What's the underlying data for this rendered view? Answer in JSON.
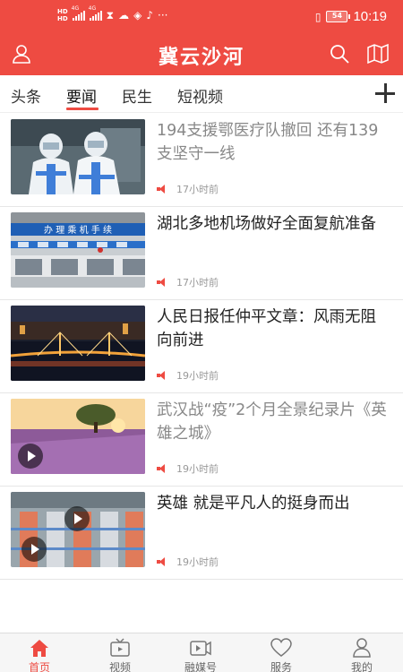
{
  "status_bar": {
    "hd1": "HD",
    "hd2": "HD",
    "net1": "4G",
    "net2": "4G",
    "battery": "54",
    "time": "10:19"
  },
  "header": {
    "title": "冀云沙河",
    "icons": [
      "user-icon",
      "search-icon",
      "map-icon"
    ]
  },
  "tabs": [
    {
      "label": "头条",
      "active": false
    },
    {
      "label": "要闻",
      "active": true
    },
    {
      "label": "民生",
      "active": false
    },
    {
      "label": "短视频",
      "active": false
    }
  ],
  "articles": [
    {
      "headline": "194支援鄂医疗队撤回 还有139支坚守一线",
      "time": "17小时前",
      "read": true,
      "video": false
    },
    {
      "headline": "湖北多地机场做好全面复航准备",
      "time": "17小时前",
      "read": false,
      "video": false,
      "thumb_text": "办 理 乘 机 手 续"
    },
    {
      "headline": "人民日报任仲平文章：风雨无阻向前进",
      "time": "19小时前",
      "read": false,
      "video": false
    },
    {
      "headline": "武汉战“疫”2个月全景纪录片《英雄之城》",
      "time": "19小时前",
      "read": true,
      "video": true
    },
    {
      "headline": "英雄 就是平凡人的挺身而出",
      "time": "19小时前",
      "read": false,
      "video": true
    }
  ],
  "bottom_nav": [
    {
      "label": "首页",
      "icon": "home-icon",
      "active": true
    },
    {
      "label": "视频",
      "icon": "tv-icon",
      "active": false
    },
    {
      "label": "融媒号",
      "icon": "media-icon",
      "active": false
    },
    {
      "label": "服务",
      "icon": "heart-icon",
      "active": false
    },
    {
      "label": "我的",
      "icon": "profile-icon",
      "active": false
    }
  ],
  "colors": {
    "accent": "#ee4b42",
    "text": "#222222",
    "read_text": "#888888",
    "meta": "#999999"
  }
}
